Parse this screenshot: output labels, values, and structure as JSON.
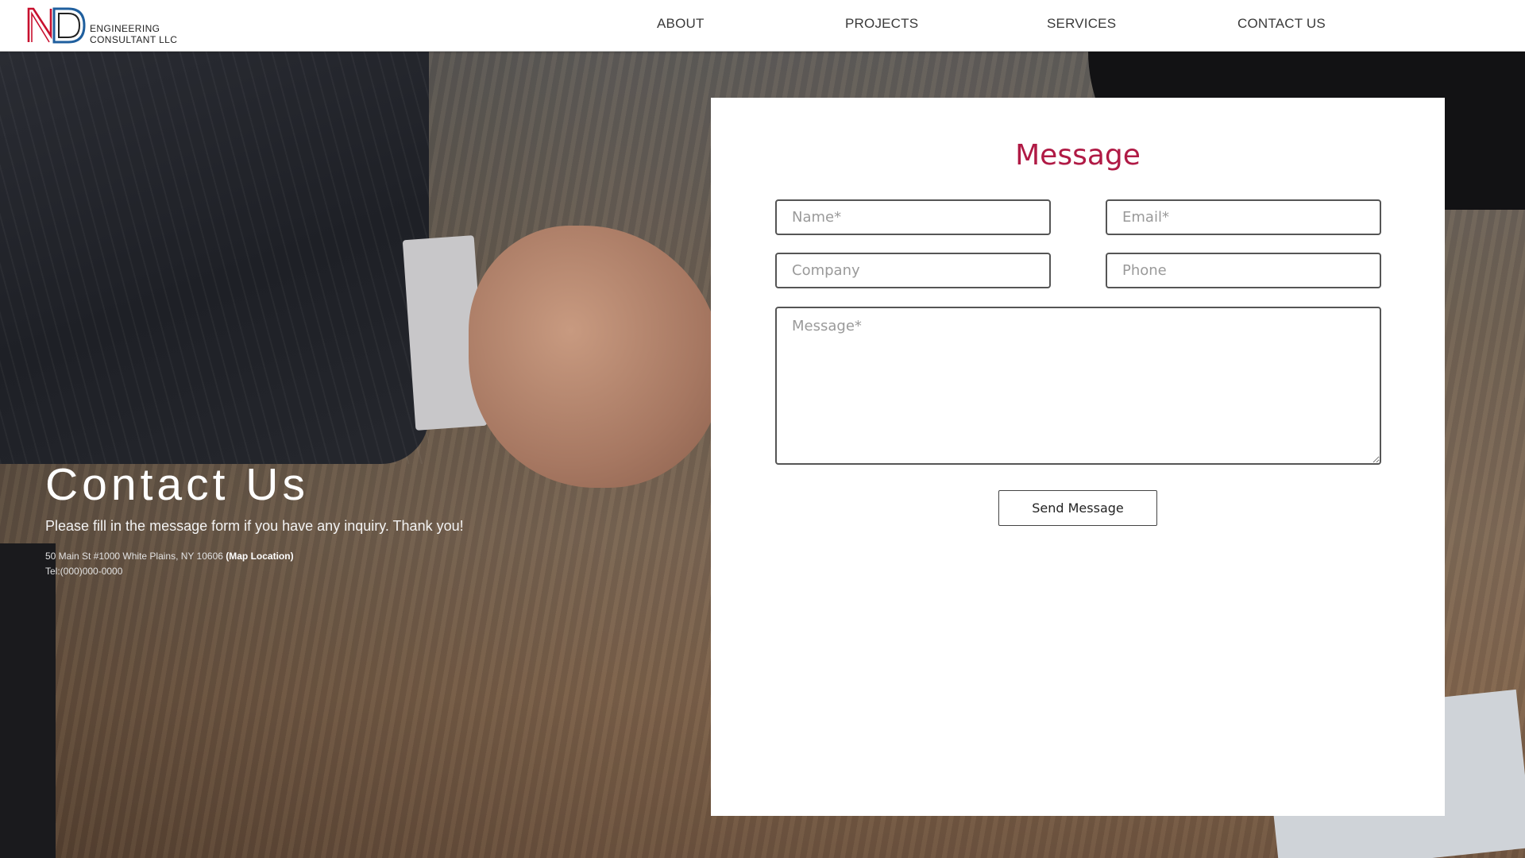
{
  "header": {
    "logo": {
      "mark": "ND",
      "line1": "ENGINEERING",
      "line2": "CONSULTANT LLC"
    },
    "nav": [
      "ABOUT",
      "PROJECTS",
      "SERVICES",
      "CONTACT US"
    ]
  },
  "hero": {
    "title": "Contact Us",
    "subtitle": "Please fill in the message form if you have any inquiry. Thank you!",
    "address": "50 Main St #1000 White Plains, NY 10606",
    "map_link": "(Map Location)",
    "tel": "Tel:(000)000-0000"
  },
  "form": {
    "title": "Message",
    "name_placeholder": "Name*",
    "email_placeholder": "Email*",
    "company_placeholder": "Company",
    "phone_placeholder": "Phone",
    "message_placeholder": "Message*",
    "submit_label": "Send Message"
  },
  "colors": {
    "accent": "#b01a45",
    "logo_red": "#c8102e",
    "logo_blue": "#1f5f9e"
  }
}
